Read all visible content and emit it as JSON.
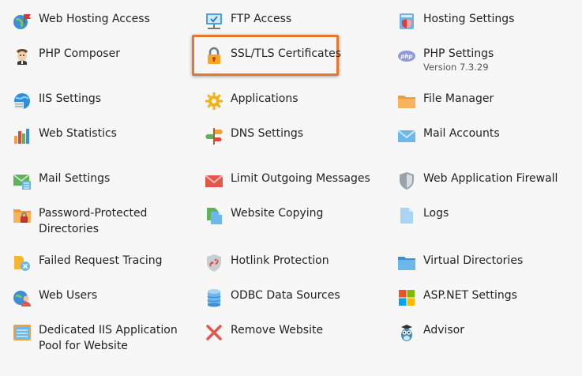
{
  "tools": {
    "web_hosting_access": "Web Hosting Access",
    "ftp_access": "FTP Access",
    "hosting_settings": "Hosting Settings",
    "php_composer": "PHP Composer",
    "ssl_tls": "SSL/TLS Certificates",
    "php_settings": "PHP Settings",
    "php_version": "Version 7.3.29",
    "iis_settings": "IIS Settings",
    "applications": "Applications",
    "file_manager": "File Manager",
    "web_statistics": "Web Statistics",
    "dns_settings": "DNS Settings",
    "mail_accounts": "Mail Accounts",
    "mail_settings": "Mail Settings",
    "limit_outgoing": "Limit Outgoing Messages",
    "waf": "Web Application Firewall",
    "password_protected_1": "Password-Protected",
    "password_protected_2": "Directories",
    "website_copying": "Website Copying",
    "logs": "Logs",
    "failed_request": "Failed Request Tracing",
    "hotlink": "Hotlink Protection",
    "virtual_dirs": "Virtual Directories",
    "web_users": "Web Users",
    "odbc": "ODBC Data Sources",
    "aspnet": "ASP.NET Settings",
    "dedicated_pool_1": "Dedicated IIS Application",
    "dedicated_pool_2": "Pool for Website",
    "remove_website": "Remove Website",
    "advisor": "Advisor"
  },
  "highlight_color": "#e8762c"
}
